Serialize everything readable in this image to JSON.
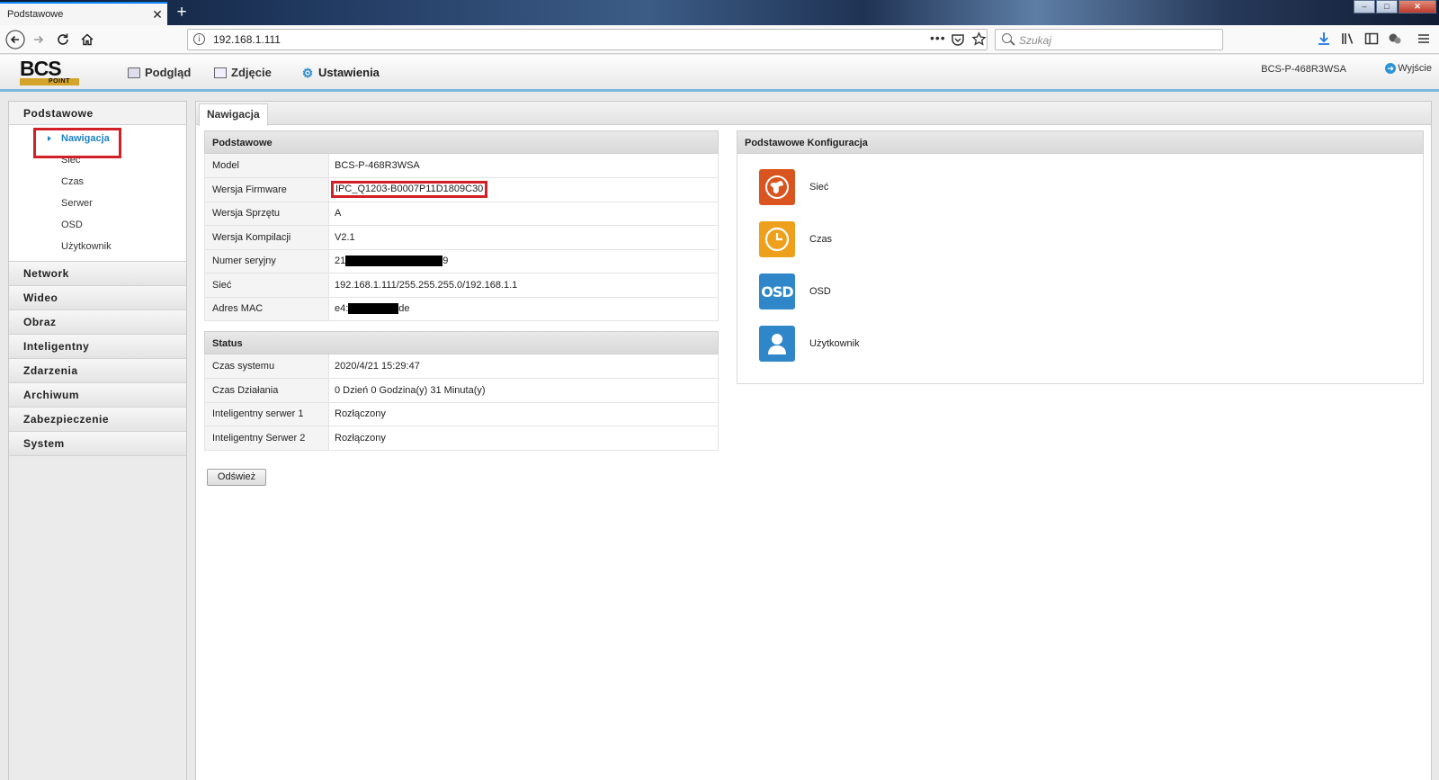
{
  "browser": {
    "tab_title": "Podstawowe",
    "tab_close": "✕",
    "new_tab": "+",
    "url": "192.168.1.111",
    "search_placeholder": "Szukaj",
    "url_more": "•••",
    "window_controls": [
      "–",
      "□",
      "✕"
    ]
  },
  "header": {
    "logo_top": "BCS",
    "logo_bottom": "POINT",
    "menu": [
      {
        "label": "Podgląd",
        "icon": "monitor-icon"
      },
      {
        "label": "Zdjęcie",
        "icon": "photo-icon"
      },
      {
        "label": "Ustawienia",
        "icon": "gear-icon"
      }
    ],
    "device_name": "BCS-P-468R3WSA",
    "logout": "Wyjście"
  },
  "sidebar": {
    "open_section": "Podstawowe",
    "sub_items": [
      "Nawigacja",
      "Sieć",
      "Czas",
      "Serwer",
      "OSD",
      "Użytkownik"
    ],
    "active_sub": "Nawigacja",
    "sections": [
      "Network",
      "Wideo",
      "Obraz",
      "Inteligentny",
      "Zdarzenia",
      "Archiwum",
      "Zabezpieczenie",
      "System"
    ]
  },
  "content": {
    "tab": "Nawigacja",
    "basic": {
      "title": "Podstawowe",
      "rows": [
        {
          "label": "Model",
          "value": "BCS-P-468R3WSA"
        },
        {
          "label": "Wersja Firmware",
          "value": "IPC_Q1203-B0007P11D1809C30"
        },
        {
          "label": "Wersja Sprzętu",
          "value": "A"
        },
        {
          "label": "Wersja Kompilacji",
          "value": "V2.1"
        },
        {
          "label": "Numer seryjny",
          "value_prefix": "21",
          "value_suffix": "9"
        },
        {
          "label": "Sieć",
          "value": "192.168.1.111/255.255.255.0/192.168.1.1"
        },
        {
          "label": "Adres MAC",
          "value_prefix": "e4:",
          "value_suffix": "de"
        }
      ]
    },
    "status": {
      "title": "Status",
      "rows": [
        {
          "label": "Czas systemu",
          "value": "2020/4/21 15:29:47"
        },
        {
          "label": "Czas Działania",
          "value": "0 Dzień 0 Godzina(y) 31 Minuta(y)"
        },
        {
          "label": "Inteligentny serwer 1",
          "value": "Rozłączony"
        },
        {
          "label": "Inteligentny Serwer 2",
          "value": "Rozłączony"
        }
      ]
    },
    "refresh_label": "Odśwież",
    "config": {
      "title": "Podstawowe Konfiguracja",
      "items": [
        {
          "label": "Sieć",
          "icon": "globe-icon"
        },
        {
          "label": "Czas",
          "icon": "clock-icon"
        },
        {
          "label": "OSD",
          "icon": "osd-icon"
        },
        {
          "label": "Użytkownik",
          "icon": "user-icon"
        }
      ],
      "osd_text": "OSD"
    }
  },
  "colors": {
    "accent_blue": "#2b93d6",
    "highlight_red": "#d31f26",
    "globe_orange": "#d9541e",
    "clock_orange": "#eea01c",
    "icon_blue": "#2f87c9"
  }
}
